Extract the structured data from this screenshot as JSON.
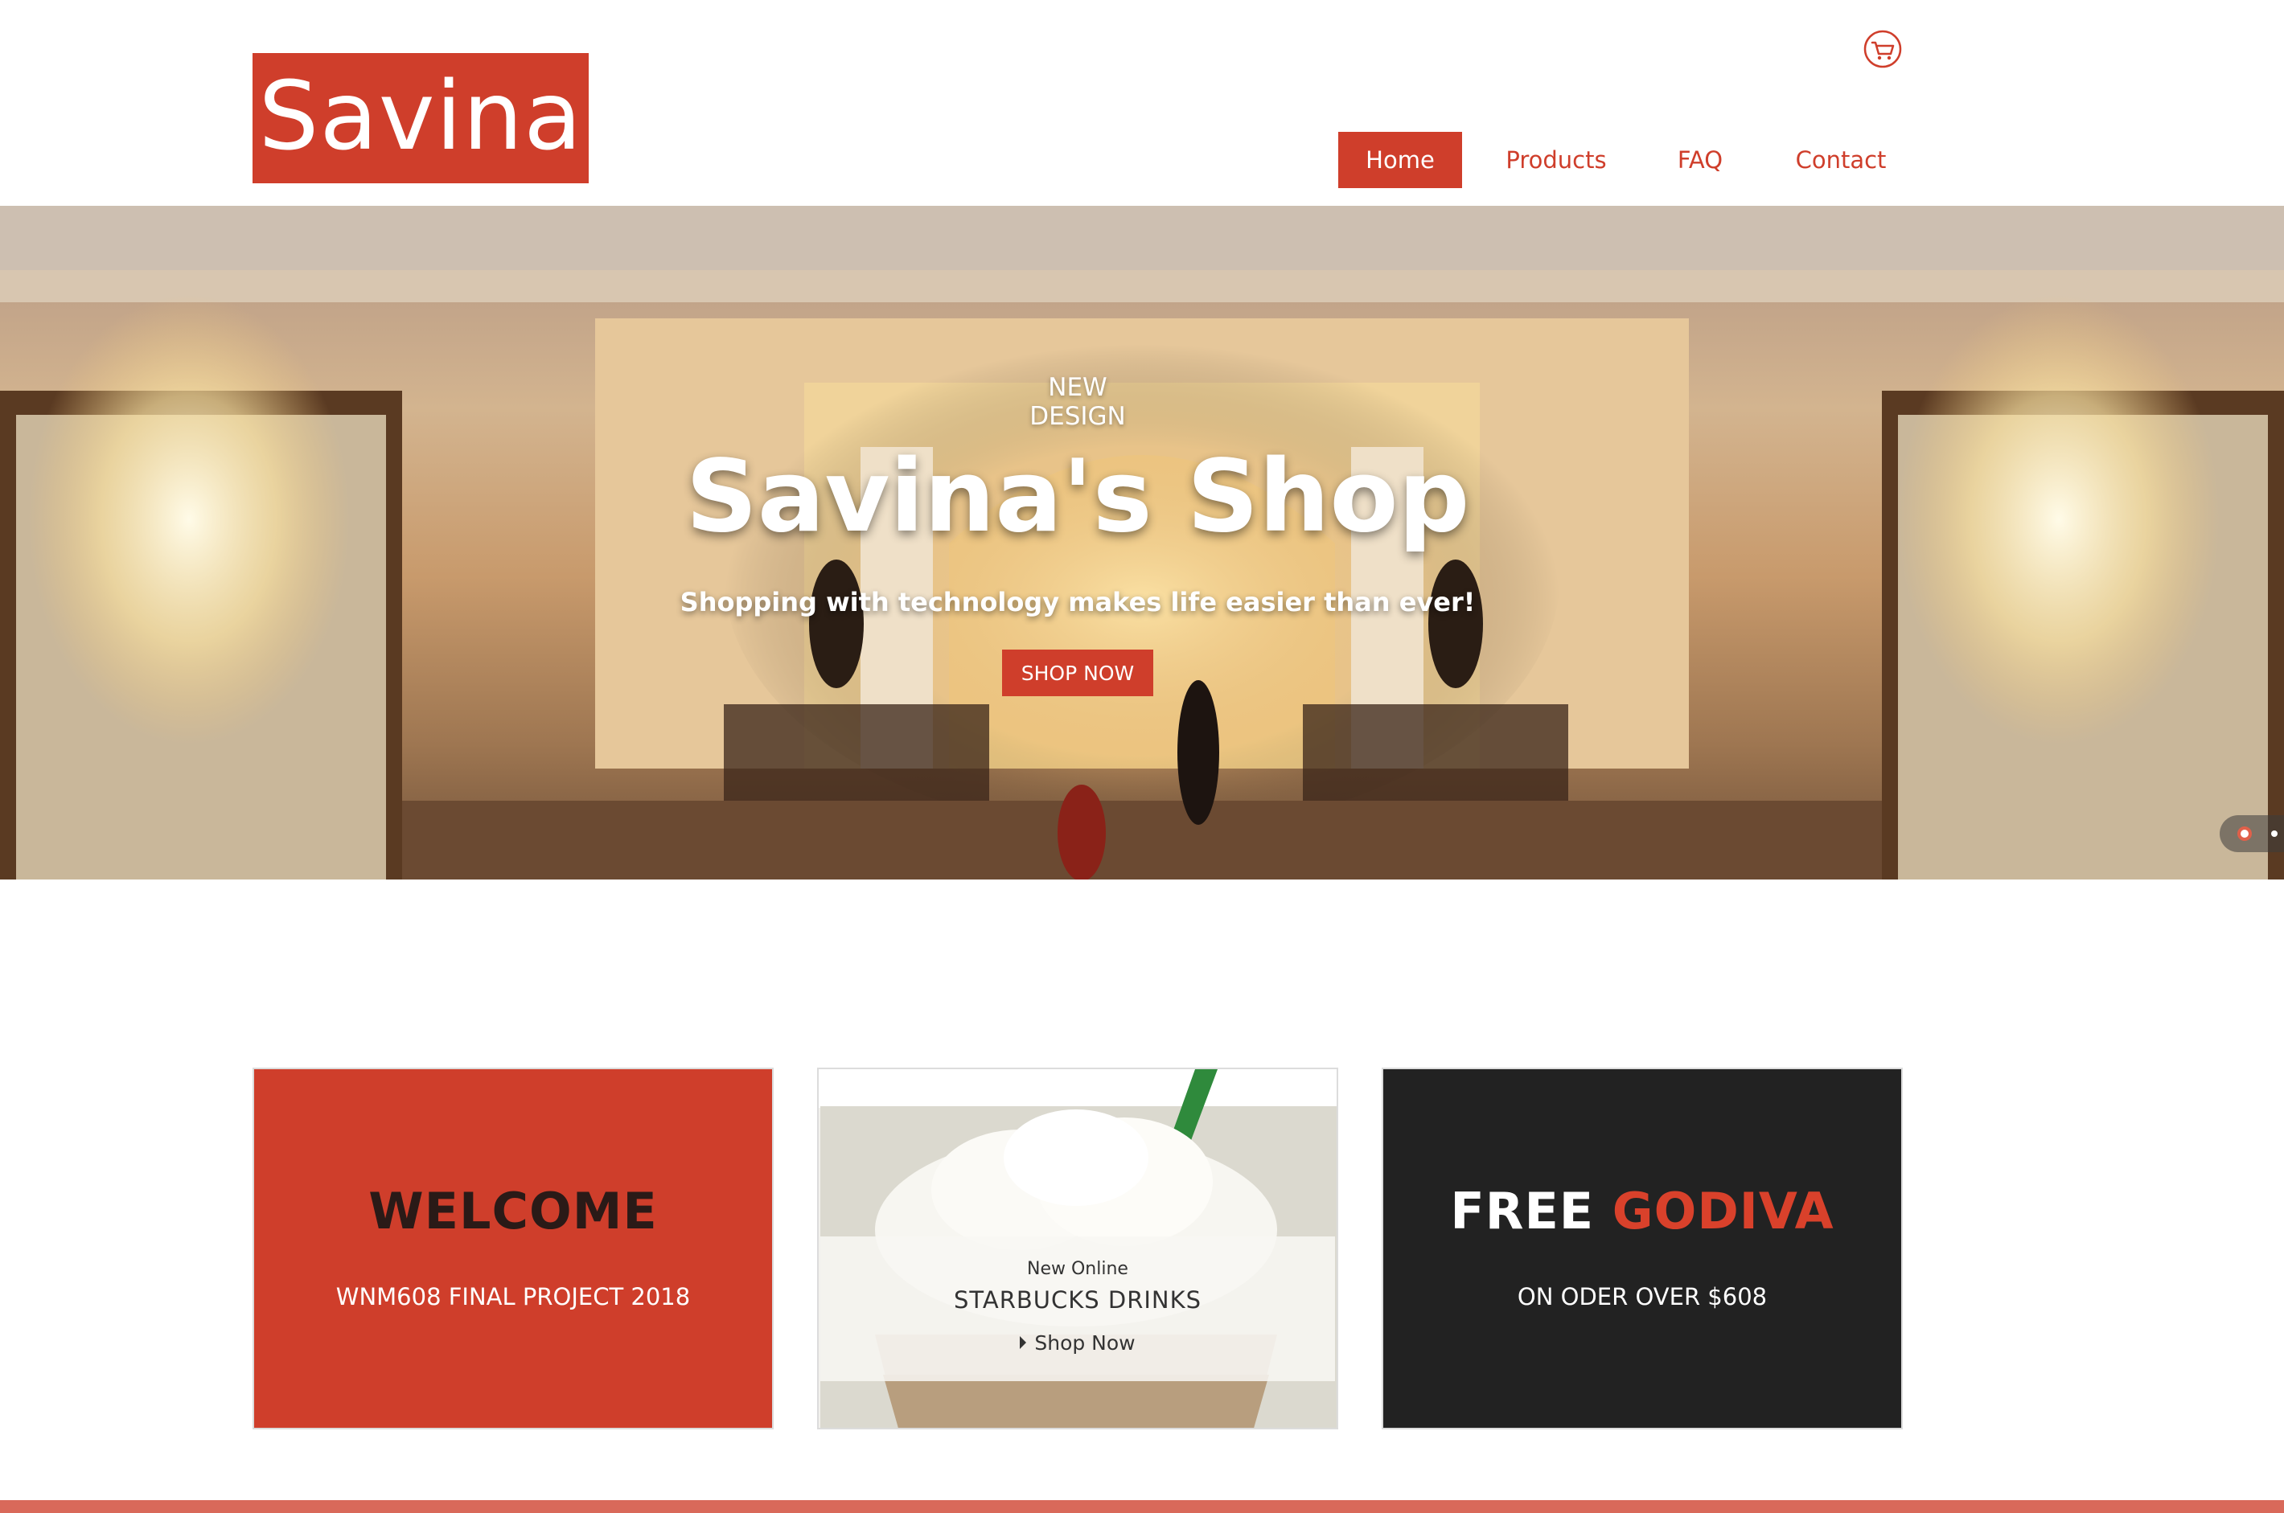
{
  "brand": {
    "logo_text": "Savina",
    "accent_color": "#cf3e2b"
  },
  "header": {
    "cart_icon": "shopping-cart-icon"
  },
  "nav": {
    "items": [
      {
        "label": "Home",
        "active": true
      },
      {
        "label": "Products",
        "active": false
      },
      {
        "label": "FAQ",
        "active": false
      },
      {
        "label": "Contact",
        "active": false
      }
    ]
  },
  "hero": {
    "subtitle": "NEW DESIGN",
    "title": "Savina's Shop",
    "tagline": "Shopping with technology makes life easier than ever!",
    "button_label": "SHOP NOW",
    "slides_count": 2,
    "active_slide": 1
  },
  "cards": {
    "welcome": {
      "title": "WELCOME",
      "subtitle": "WNM608 FINAL PROJECT 2018"
    },
    "starbucks": {
      "kicker": "New Online",
      "title": "STARBUCKS DRINKS",
      "link_label": "Shop Now"
    },
    "godiva": {
      "title_part1": "FREE",
      "title_part2": "GODIVA",
      "subtitle": "ON ODER OVER $608"
    }
  }
}
